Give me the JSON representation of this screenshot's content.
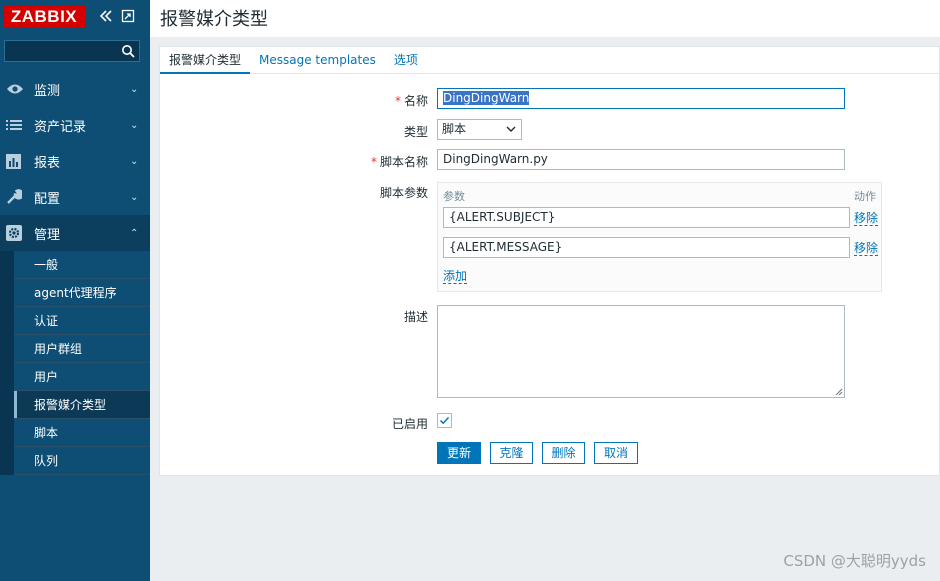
{
  "sidebar": {
    "logo": "ZABBIX",
    "search_placeholder": "",
    "menu": [
      {
        "label": "监测",
        "icon": "eye-icon"
      },
      {
        "label": "资产记录",
        "icon": "list-icon"
      },
      {
        "label": "报表",
        "icon": "bar-chart-icon"
      },
      {
        "label": "配置",
        "icon": "wrench-icon"
      },
      {
        "label": "管理",
        "icon": "gear-icon"
      }
    ],
    "submenu": [
      "一般",
      "agent代理程序",
      "认证",
      "用户群组",
      "用户",
      "报警媒介类型",
      "脚本",
      "队列"
    ]
  },
  "page": {
    "title": "报警媒介类型"
  },
  "tabs": [
    "报警媒介类型",
    "Message templates",
    "选项"
  ],
  "form": {
    "name_label": "名称",
    "name_value": "DingDingWarn",
    "type_label": "类型",
    "type_value": "脚本",
    "script_label": "脚本名称",
    "script_value": "DingDingWarn.py",
    "params_label": "脚本参数",
    "params_header": "参数",
    "params_action_header": "动作",
    "params": [
      "{ALERT.SUBJECT}",
      "{ALERT.MESSAGE}"
    ],
    "remove_label": "移除",
    "add_label": "添加",
    "desc_label": "描述",
    "desc_value": "",
    "enabled_label": "已启用",
    "enabled": true
  },
  "buttons": {
    "update": "更新",
    "clone": "克隆",
    "delete": "删除",
    "cancel": "取消"
  },
  "watermark": "CSDN @大聪明yyds"
}
